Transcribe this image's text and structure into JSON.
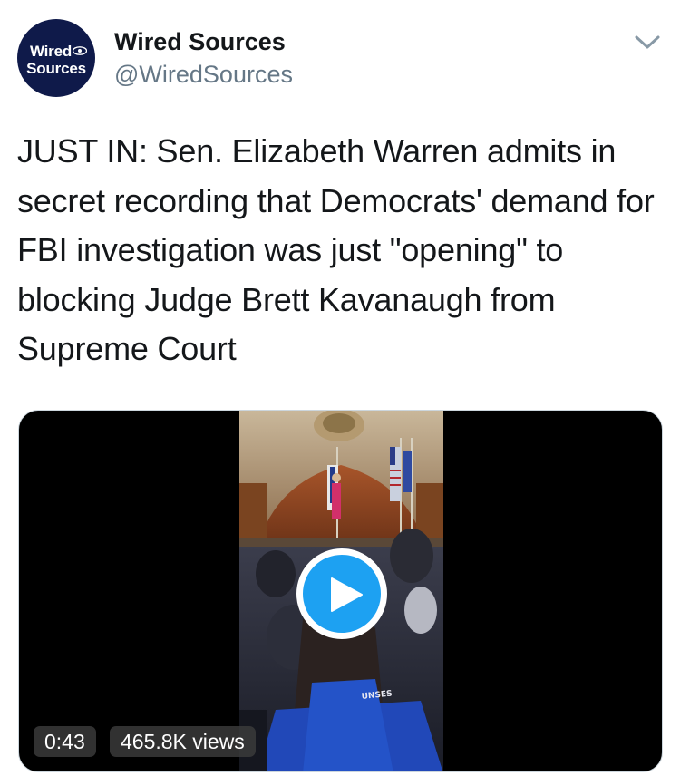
{
  "author": {
    "avatar_line1": "Wired",
    "avatar_line2": "Sources",
    "display_name": "Wired Sources",
    "handle": "@WiredSources",
    "avatar_bg": "#0f1a4a"
  },
  "menu": {
    "icon": "chevron-down-icon"
  },
  "tweet": {
    "text": "JUST IN: Sen. Elizabeth Warren admits in secret recording that Democrats' demand for FBI investigation was just \"opening\" to blocking Judge Brett Kavanaugh from Supreme Court"
  },
  "media": {
    "type": "video",
    "duration": "0:43",
    "views": "465.8K views",
    "play_icon": "play-icon",
    "play_color": "#1da1f2"
  }
}
